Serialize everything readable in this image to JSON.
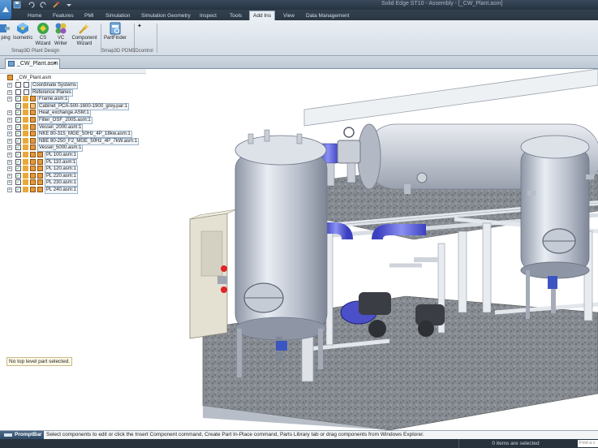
{
  "window": {
    "title": "Solid Edge ST10 - Assembly - [_CW_Plant.asm]"
  },
  "ribbon": {
    "tabs": [
      {
        "label": "Home"
      },
      {
        "label": "Features"
      },
      {
        "label": "PMI"
      },
      {
        "label": "Simulation"
      },
      {
        "label": "Simulation Geometry"
      },
      {
        "label": "Inspect"
      },
      {
        "label": "Tools"
      },
      {
        "label": "Add Ins",
        "active": true
      },
      {
        "label": "View"
      },
      {
        "label": "Data Management"
      }
    ],
    "buttons": {
      "piping": "ping",
      "isometric": "Isometric",
      "cs_wizard_1": "CS",
      "cs_wizard_2": "Wizard",
      "vc_writer_1": "VC",
      "vc_writer_2": "Writer",
      "component_wizard_1": "Component",
      "component_wizard_2": "Wizard",
      "partfinder": "PartFinder"
    },
    "groups": {
      "plant_design": "Smap3D Plant Design",
      "pdm": "Smap3D PDM",
      "threed_control": "3Dcontrol"
    }
  },
  "document": {
    "tab_label": "_CW_Plant.asm",
    "close_glyph": "×"
  },
  "tree": {
    "root": "_CW_Plant.asm",
    "coordinate_systems": "Coordinate Systems",
    "reference_planes": "Reference Planes",
    "frame": "Frame.asm:1",
    "cabinet": "Cabinet_PCA-500-1600-1900_grey.par:1",
    "heat_exchange": "Heat_exchange.ASM:1",
    "filter": "Filter_OSF_2005.asm:1",
    "vessel_2000": "Vessel_2000.asm:1",
    "nke": "NKE 80-315_MGE_50Hz_4P_18kw.asm:1",
    "nbe": "NBE 80-250_F2_MGE_50Hz_4P_7kW.asm:1",
    "vessel_5000": "Vessel_5000.asm:1",
    "pl100": "PL 100.asm:1",
    "pl110": "PL 110.asm:1",
    "pl120": "PL 120.asm:1",
    "pl220": "PL 220.asm:1",
    "pl230": "PL 230.asm:1",
    "pl240": "PL 240.asm:1",
    "no_selection": "No top level part selected."
  },
  "promptbar": {
    "title": "PromptBar",
    "text": "Select components to edit or click the Insert Component command, Create Part In-Place command, Parts Library tab or drag components from Windows Explorer."
  },
  "statusbar": {
    "items_selected": "0 items are selected",
    "find_command": "Find a c"
  },
  "colors": {
    "titlebar": "#2b3744",
    "ribbon": "#dfe6ed",
    "vessel": "#c7ccd8",
    "pipe_blue": "#5a62e6",
    "frame_pipe": "#dde2e8",
    "grating": "#7d8389"
  }
}
